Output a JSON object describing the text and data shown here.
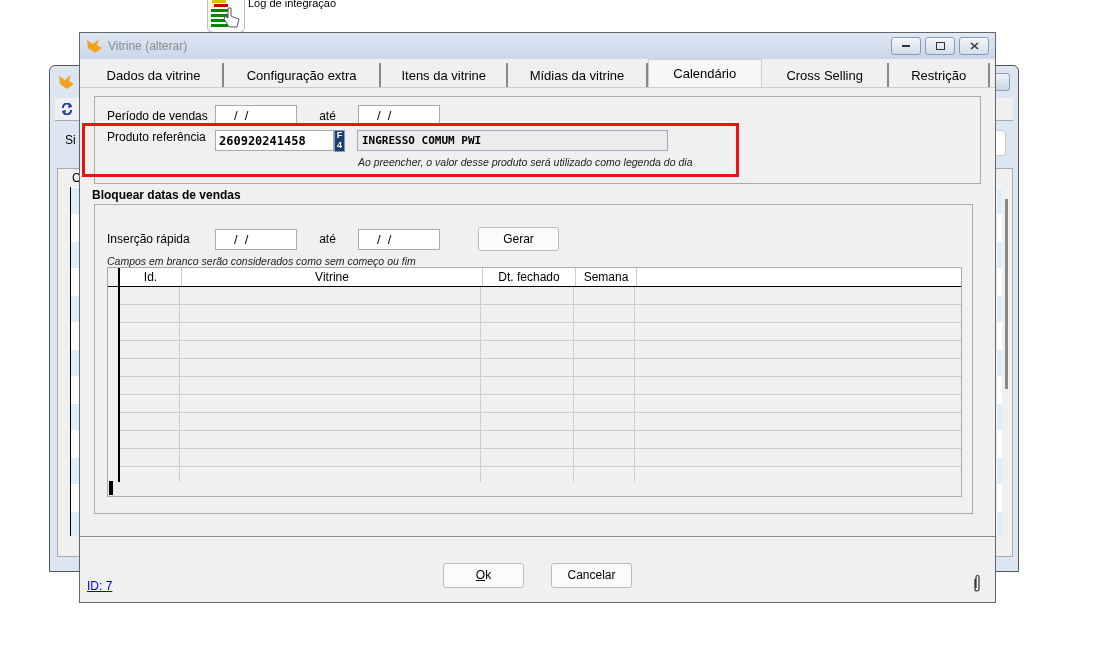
{
  "desktop_icon": {
    "label": "Log de integração"
  },
  "back_window": {
    "toolbar_label": "Si",
    "grid_header": "C"
  },
  "window": {
    "title": "Vitrine (alterar)",
    "active": false
  },
  "tabs": [
    {
      "label": "Dados da vitrine",
      "selected": false
    },
    {
      "label": "Configuração extra",
      "selected": false
    },
    {
      "label": "Itens da vitrine",
      "selected": false
    },
    {
      "label": "Mídias da vitrine",
      "selected": false
    },
    {
      "label": "Calendário",
      "selected": true
    },
    {
      "label": "Cross Selling",
      "selected": false
    },
    {
      "label": "Restrição",
      "selected": false
    }
  ],
  "sales_period": {
    "label": "Período de vendas",
    "from": "/  /",
    "to_label": "até",
    "to": "/  /"
  },
  "reference_product": {
    "label": "Produto referência",
    "code": "260920241458",
    "lookup_key": "F4",
    "description": "INGRESSO COMUM PWI",
    "hint": "Ao preencher, o valor desse produto será utilizado como legenda do dia"
  },
  "block_dates": {
    "title": "Bloquear datas de vendas",
    "quick_label": "Inserção rápida",
    "from": "/  /",
    "to_label": "até",
    "to": "/  /",
    "generate_button": "Gerar",
    "hint": "Campos em branco serão considerados como sem começo ou fim",
    "table": {
      "columns": [
        "Id.",
        "Vitrine",
        "Dt. fechado",
        "Semana"
      ]
    }
  },
  "footer": {
    "id_link": "ID: 7",
    "buttons": [
      "Ok",
      "Cancelar"
    ]
  }
}
